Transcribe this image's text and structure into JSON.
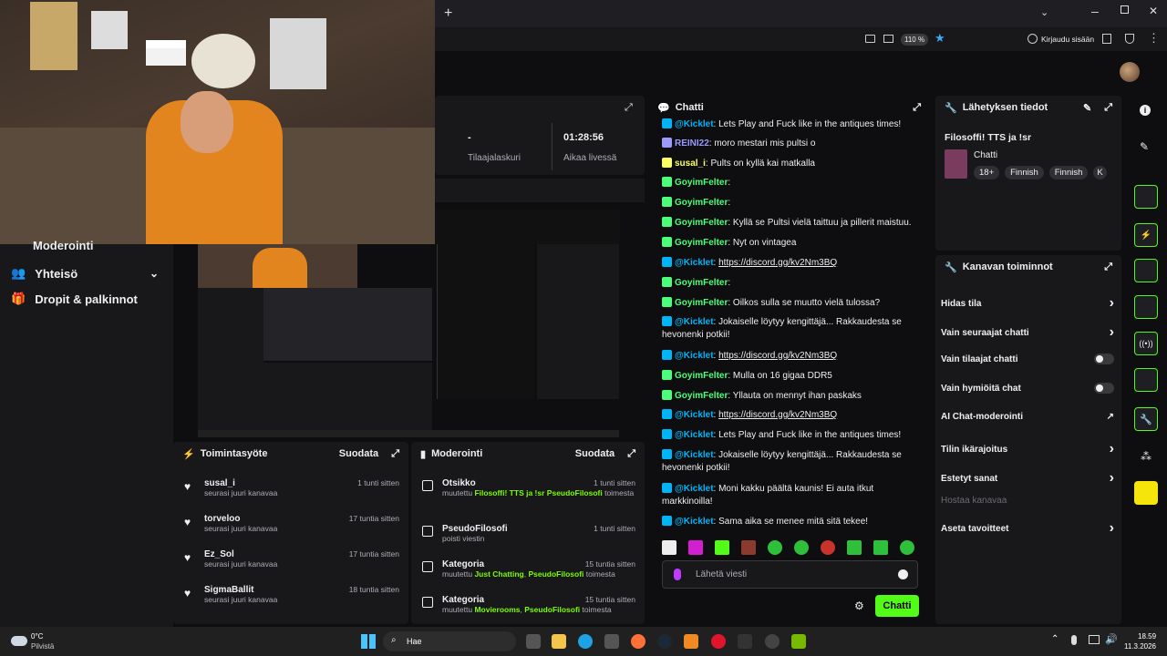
{
  "browser": {
    "zoom": "110 %",
    "login": "Kirjaudu sisään"
  },
  "leftnav": {
    "items": [
      {
        "label": "Moderointi"
      },
      {
        "label": "Yhteisö"
      },
      {
        "label": "Dropit & palkinnot"
      }
    ]
  },
  "stats": {
    "subs_value": "-",
    "subs_label": "Tilaajalaskuri",
    "live_value": "01:28:56",
    "live_label": "Aikaa livessä"
  },
  "chat": {
    "title": "Chatti",
    "messages": [
      {
        "user": "@Kicklet",
        "text": ": Lets Play and Fuck like in the antiques times!",
        "color": "#00b5f7"
      },
      {
        "user": "REINI22",
        "text": ": moro mestari mis pultsi o",
        "color": "#9a9aff"
      },
      {
        "user": "susal_i",
        "text": ": Pults on kyllä kai matkalla",
        "color": "#ffff66"
      },
      {
        "user": "GoyimFelter",
        "text": ":",
        "color": "#4cff7a"
      },
      {
        "user": "GoyimFelter",
        "text": ":",
        "color": "#4cff7a"
      },
      {
        "user": "GoyimFelter",
        "text": ": Kyllä se Pultsi vielä taittuu ja pillerit maistuu.",
        "color": "#4cff7a"
      },
      {
        "user": "GoyimFelter",
        "text": ": Nyt on vintagea",
        "color": "#4cff7a"
      },
      {
        "user": "@Kicklet",
        "text": ": ",
        "link": "https://discord.gg/kv2Nm3BQ",
        "color": "#00b5f7"
      },
      {
        "user": "GoyimFelter",
        "text": ":",
        "color": "#4cff7a"
      },
      {
        "user": "GoyimFelter",
        "text": ": Oilkos sulla se muutto vielä tulossa?",
        "color": "#4cff7a"
      },
      {
        "user": "@Kicklet",
        "text": ": Jokaiselle löytyy kengittäjä... Rakkaudesta se hevonenki potkii!",
        "color": "#00b5f7"
      },
      {
        "user": "@Kicklet",
        "text": ": ",
        "link": "https://discord.gg/kv2Nm3BQ",
        "color": "#00b5f7"
      },
      {
        "user": "GoyimFelter",
        "text": ": Mulla on 16 gigaa DDR5",
        "color": "#4cff7a"
      },
      {
        "user": "GoyimFelter",
        "text": ": Yllauta on mennyt ihan paskaks",
        "color": "#4cff7a"
      },
      {
        "user": "@Kicklet",
        "text": ": ",
        "link": "https://discord.gg/kv2Nm3BQ",
        "color": "#00b5f7"
      },
      {
        "user": "@Kicklet",
        "text": ": Lets Play and Fuck like in the antiques times!",
        "color": "#00b5f7"
      },
      {
        "user": "@Kicklet",
        "text": ": Jokaiselle löytyy kengittäjä... Rakkaudesta se hevonenki potkii!",
        "color": "#00b5f7"
      },
      {
        "user": "@Kicklet",
        "text": ": Moni kakku päältä kaunis! Ei auta itkut markkinoilla!",
        "color": "#00b5f7"
      },
      {
        "user": "@Kicklet",
        "text": ": Sama aika se menee mitä sitä tekee!",
        "color": "#00b5f7"
      }
    ],
    "input_placeholder": "Lähetä viesti",
    "send_label": "Chatti"
  },
  "streaminfo": {
    "title": "Lähetyksen tiedot",
    "stream_title": "Filosoffi! TTS ja !sr",
    "category": "Chatti",
    "tags": [
      "18+",
      "Finnish",
      "Finnish",
      "K"
    ]
  },
  "channelactions": {
    "title": "Kanavan toiminnot",
    "rows": [
      {
        "label": "Hidas tila",
        "control": "chevron"
      },
      {
        "label": "Vain seuraajat chatti",
        "control": "chevron"
      },
      {
        "label": "Vain tilaajat chatti",
        "control": "toggle"
      },
      {
        "label": "Vain hymiöitä chat",
        "control": "toggle"
      },
      {
        "label": "AI Chat-moderointi",
        "control": "external"
      },
      {
        "label": "Tilin ikärajoitus",
        "control": "chevron"
      },
      {
        "label": "Estetyt sanat",
        "control": "chevron"
      },
      {
        "label": "Hostaa kanavaa",
        "control": "none"
      },
      {
        "label": "Aseta tavoitteet",
        "control": "chevron"
      }
    ]
  },
  "activity": {
    "title": "Toimintasyöte",
    "filter": "Suodata",
    "items": [
      {
        "name": "susal_i",
        "sub": "seurasi juuri kanavaa",
        "time": "1 tunti sitten"
      },
      {
        "name": "torveloo",
        "sub": "seurasi juuri kanavaa",
        "time": "17 tuntia sitten"
      },
      {
        "name": "Ez_Sol",
        "sub": "seurasi juuri kanavaa",
        "time": "17 tuntia sitten"
      },
      {
        "name": "SigmaBallit",
        "sub": "seurasi juuri kanavaa",
        "time": "18 tuntia sitten"
      }
    ]
  },
  "moderation": {
    "title": "Moderointi",
    "filter": "Suodata",
    "items": [
      {
        "name": "Otsikko",
        "pre": "muutettu ",
        "value": "Filosoffi! TTS ja !sr",
        "mid": " ",
        "user": "PseudoFilosofi",
        "post": " toimesta",
        "time": "1 tunti sitten"
      },
      {
        "name": "PseudoFilosofi",
        "pre": "poisti viestin",
        "value": "",
        "mid": "",
        "user": "",
        "post": "",
        "time": "1 tunti sitten"
      },
      {
        "name": "Kategoria",
        "pre": "muutettu ",
        "value": "Just Chatting",
        "mid": ", ",
        "user": "PseudoFilosofi",
        "post": " toimesta",
        "time": "15 tuntia sitten"
      },
      {
        "name": "Kategoria",
        "pre": "muutettu ",
        "value": "Movierooms",
        "mid": ", ",
        "user": "PseudoFilosofi",
        "post": " toimesta",
        "time": "15 tuntia sitten"
      }
    ]
  },
  "taskbar": {
    "weather_temp": "0°C",
    "weather_desc": "Pilvistä",
    "search": "Hae",
    "time": "18.59",
    "date": "11.3.2026"
  },
  "colors": {
    "accent_green": "#53fc18",
    "panel_bg": "#18181b",
    "page_bg": "#0e0e10"
  }
}
